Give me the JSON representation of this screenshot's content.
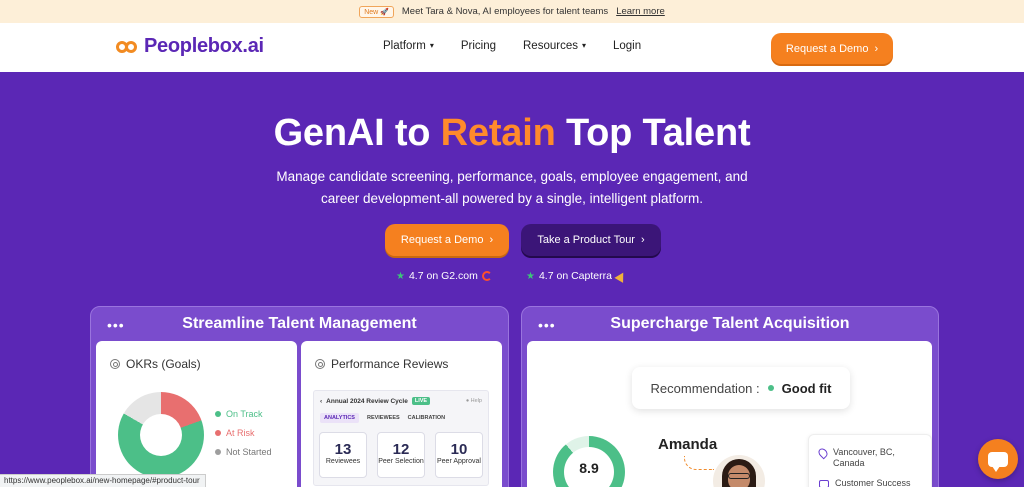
{
  "announcement": {
    "badge": "New 🚀",
    "text": "Meet Tara & Nova, AI employees for talent teams",
    "link": "Learn more"
  },
  "nav": {
    "logo": "Peoplebox.ai",
    "items": [
      {
        "label": "Platform",
        "has_dropdown": true
      },
      {
        "label": "Pricing",
        "has_dropdown": false
      },
      {
        "label": "Resources",
        "has_dropdown": true
      },
      {
        "label": "Login",
        "has_dropdown": false
      }
    ],
    "cta": "Request a Demo"
  },
  "hero": {
    "title_pre": "GenAI to ",
    "title_accent": "Retain",
    "title_post": " Top Talent",
    "subtitle": "Manage candidate screening, performance, goals, employee engagement, and career development-all powered by a single, intelligent platform.",
    "primary_cta": "Request a Demo",
    "secondary_cta": "Take a Product Tour",
    "ratings": [
      {
        "label": "4.7 on G2.com"
      },
      {
        "label": "4.7 on Capterra"
      }
    ]
  },
  "cards": {
    "left": {
      "title": "Streamline Talent Management",
      "dots": "•••",
      "okr": {
        "title": "OKRs (Goals)",
        "legend": [
          {
            "label": "On Track",
            "color": "#4cbf88"
          },
          {
            "label": "At Risk",
            "color": "#e86f6f"
          },
          {
            "label": "Not Started",
            "color": "#9e9e9e"
          }
        ]
      },
      "performance": {
        "title": "Performance Reviews",
        "cycle": "Annual 2024 Review Cycle",
        "live": "LIVE",
        "help": "● Help",
        "tabs": [
          "ANALYTICS",
          "REVIEWEES",
          "CALIBRATION"
        ],
        "stats": [
          {
            "num": "13",
            "label": "Reviewees"
          },
          {
            "num": "12",
            "label": "Peer Selection"
          },
          {
            "num": "10",
            "label": "Peer Approval"
          }
        ]
      }
    },
    "right": {
      "title": "Supercharge Talent Acquisition",
      "dots": "•••",
      "recommendation_label": "Recommendation :",
      "recommendation_value": "Good fit",
      "score": "8.9",
      "candidate": "Amanda",
      "location": "Vancouver, BC, Canada",
      "role": "Customer Success"
    }
  },
  "status_url": "https://www.peoplebox.ai/new-homepage/#product-tour",
  "colors": {
    "brand": "#5b27b5",
    "accent": "#f5801f"
  }
}
